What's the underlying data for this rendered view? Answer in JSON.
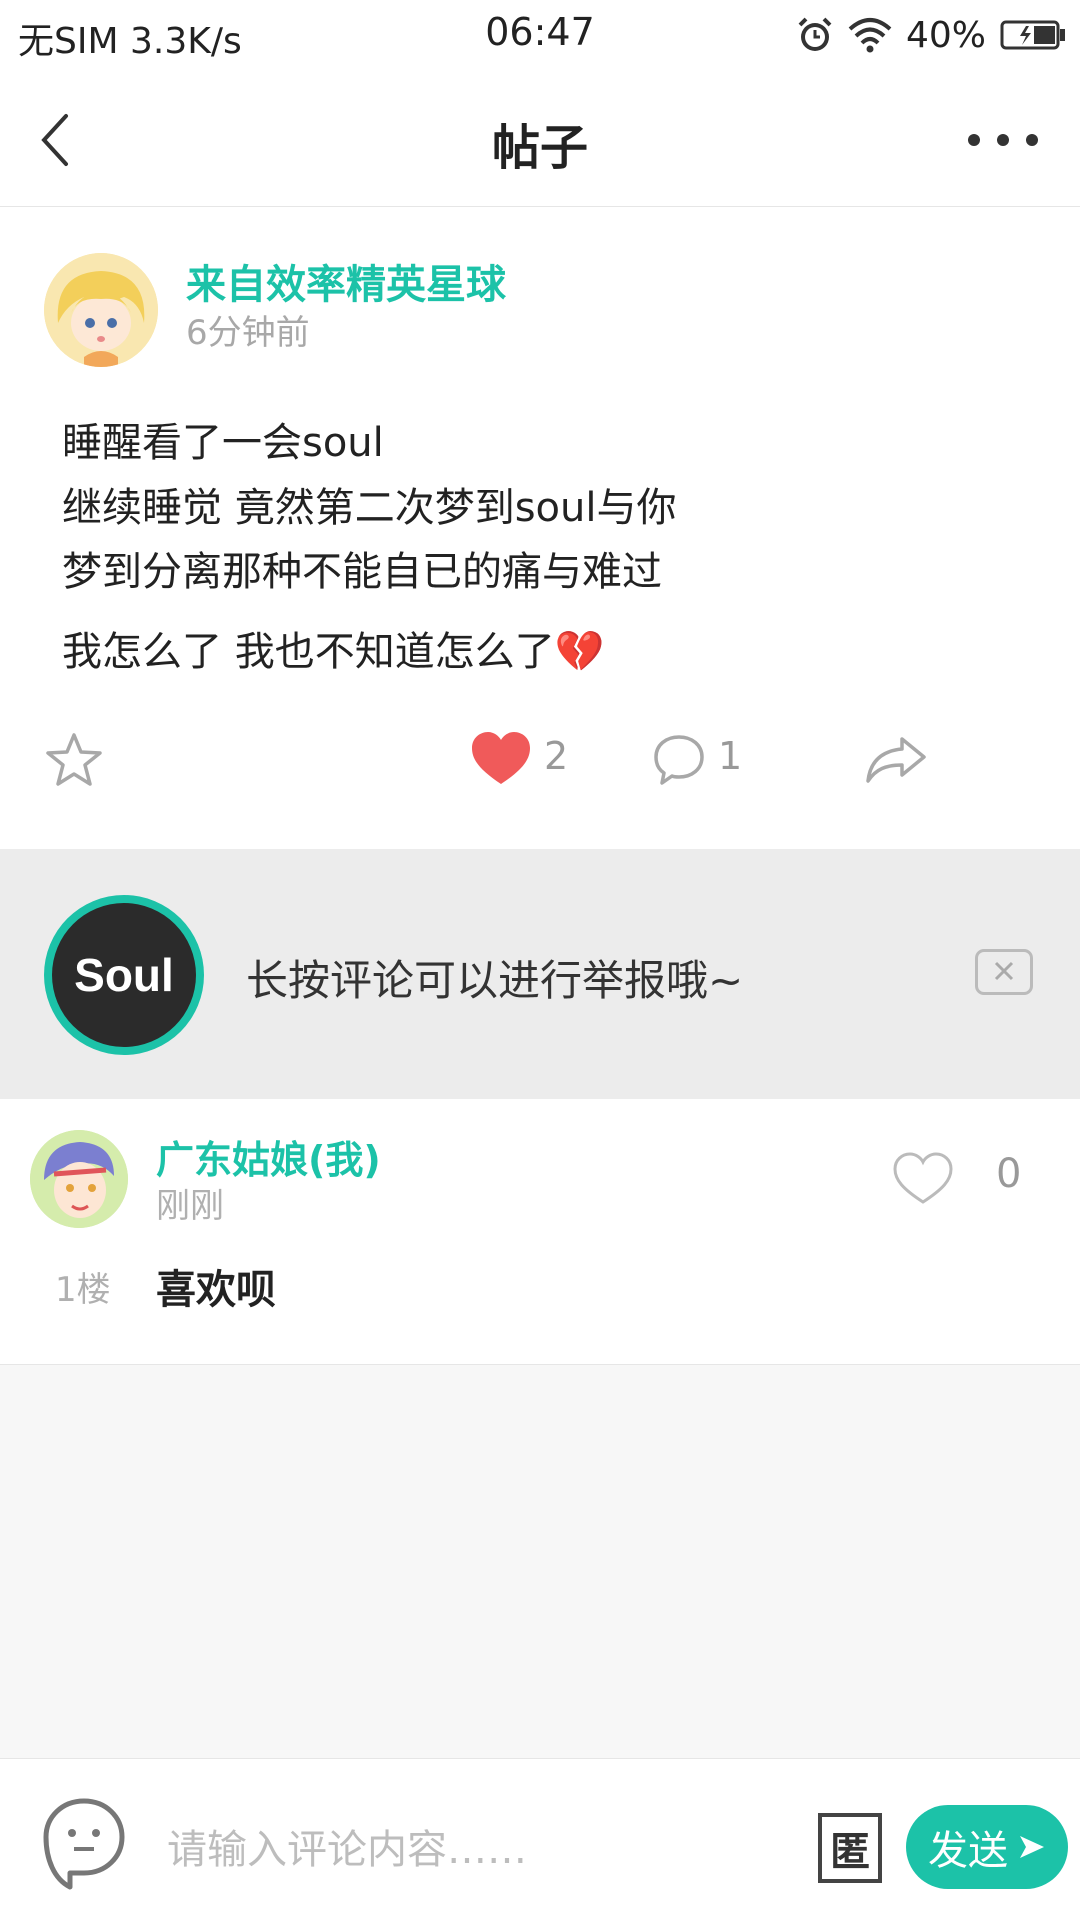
{
  "status_bar": {
    "carrier_speed": "无SIM 3.3K/s",
    "time": "06:47",
    "battery": "40%"
  },
  "header": {
    "title": "帖子"
  },
  "post": {
    "author": "来自效率精英星球",
    "time": "6分钟前",
    "lines": [
      "睡醒看了一会soul",
      "继续睡觉 竟然第二次梦到soul与你",
      "梦到分离那种不能自已的痛与难过",
      "我怎么了 我也不知道怎么了💔"
    ],
    "like_count": "2",
    "comment_count": "1",
    "accent_color": "#1cc2a8",
    "like_color": "#f05a5a"
  },
  "notice": {
    "logo_text": "Soul",
    "text": "长按评论可以进行举报哦~"
  },
  "comment": {
    "author": "广东姑娘(我)",
    "time": "刚刚",
    "floor": "1楼",
    "text": "喜欢呗",
    "like_count": "0"
  },
  "bottom_bar": {
    "input_placeholder": "请输入评论内容……",
    "anon_label": "匿",
    "send_label": "发送"
  }
}
